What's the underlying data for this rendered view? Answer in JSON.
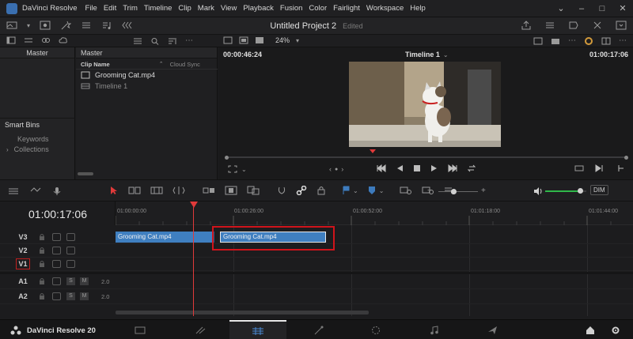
{
  "app": {
    "name": "DaVinci Resolve",
    "menus": [
      "File",
      "Edit",
      "Trim",
      "Timeline",
      "Clip",
      "Mark",
      "View",
      "Playback",
      "Fusion",
      "Color",
      "Fairlight",
      "Workspace",
      "Help"
    ],
    "project_title": "Untitled Project 2",
    "project_status": "Edited",
    "brand_footer": "DaVinci Resolve 20"
  },
  "toolbar2": {
    "zoom": "24%"
  },
  "media_pool": {
    "bins_header": "Master",
    "smart_bins_title": "Smart Bins",
    "smart_bins": [
      "Keywords",
      "Collections"
    ],
    "clips_header": "Master",
    "columns": {
      "name": "Clip Name",
      "cloud": "Cloud Sync"
    },
    "clips": [
      {
        "name": "Grooming Cat.mp4",
        "icon": "video-clip-icon"
      },
      {
        "name": "Timeline 1",
        "icon": "timeline-icon"
      }
    ]
  },
  "viewer": {
    "source_timecode": "00:00:46:24",
    "timeline_name": "Timeline 1",
    "record_timecode": "01:00:17:06"
  },
  "timeline_toolbar": {
    "dim_label": "DIM",
    "volume_level": 0.85
  },
  "timeline": {
    "current_timecode": "01:00:17:06",
    "ruler_ticks": [
      "01:00:00:00",
      "01:00:26:00",
      "01:00:52:00",
      "01:01:18:00",
      "01:01:44:00"
    ],
    "video_tracks": [
      "V3",
      "V2",
      "V1"
    ],
    "audio_tracks": [
      {
        "name": "A1",
        "level": "2.0"
      },
      {
        "name": "A2",
        "level": "2.0"
      }
    ],
    "solo_label": "S",
    "mute_label": "M",
    "clips": [
      {
        "name": "Grooming Cat.mp4",
        "track": "V3"
      },
      {
        "name": "Grooming Cat.mp4",
        "track": "V3",
        "selected": true
      }
    ]
  },
  "colors": {
    "accent_blue": "#3d7bbd",
    "playhead_red": "#e03a3a",
    "highlight_red": "#d0141b",
    "clip_blue": "#3f7fc0"
  }
}
